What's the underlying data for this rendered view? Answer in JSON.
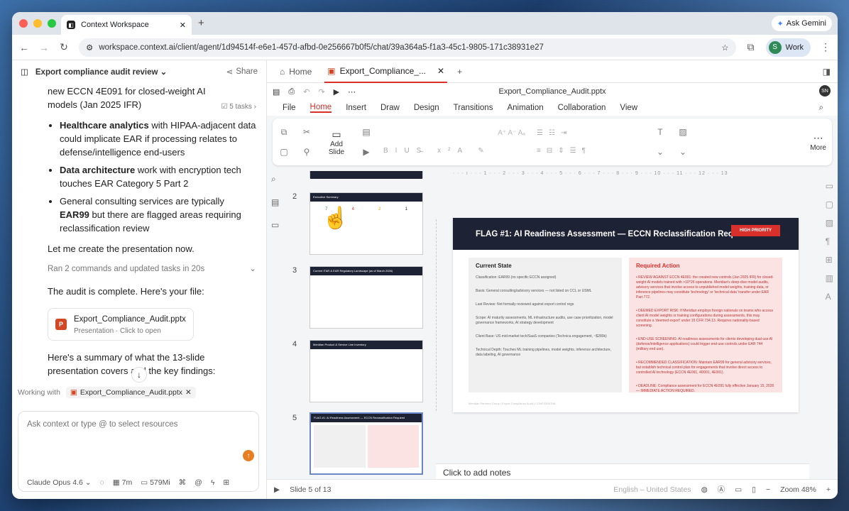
{
  "browser": {
    "tab_title": "Context Workspace",
    "gemini_label": "Ask Gemini",
    "url": "workspace.context.ai/client/agent/1d94514f-e6e1-457d-afbd-0e256667b0f5/chat/39a364a5-f1a3-45c1-9805-171c38931e27",
    "profile_initial": "S",
    "profile_label": "Work"
  },
  "left": {
    "title": "Export compliance audit review",
    "share_label": "Share",
    "intro_text": "new ECCN 4E091 for closed-weight AI models (Jan 2025 IFR)",
    "tasks_label": "5 tasks",
    "bullets": [
      {
        "bold": "Healthcare analytics",
        "text": " with HIPAA-adjacent data could implicate EAR if processing relates to defense/intelligence end-users"
      },
      {
        "bold": "Data architecture",
        "text": " work with encryption tech touches EAR Category 5 Part 2"
      },
      {
        "pre": "General consulting services are typically ",
        "bold": "EAR99",
        "text": " but there are flagged areas requiring reclassification review"
      }
    ],
    "create_text": "Let me create the presentation now.",
    "ran_text": "Ran 2 commands and updated tasks in 20s",
    "complete_text": "The audit is complete. Here's your file:",
    "file_name": "Export_Compliance_Audit.pptx",
    "file_sub": "Presentation · Click to open",
    "summary_text": "Here's a summary of what the 13-slide presentation covers and the key findings:",
    "working_with": "Working with",
    "working_file": "Export_Compliance_Audit.pptx",
    "input_placeholder": "Ask context or type @ to select resources",
    "model": "Claude Opus 4.6",
    "time": "7m",
    "memory": "579Mi"
  },
  "right": {
    "home_tab": "Home",
    "file_tab": "Export_Compliance_...",
    "file_title": "Export_Compliance_Audit.pptx",
    "user_initials": "SN",
    "menus": [
      "File",
      "Home",
      "Insert",
      "Draw",
      "Design",
      "Transitions",
      "Animation",
      "Collaboration",
      "View"
    ],
    "add_slide": "Add Slide",
    "more_label": "More",
    "thumbnails": [
      {
        "num": "2",
        "title": "Executive Summary",
        "stats": [
          "7",
          "4",
          "2",
          "1"
        ]
      },
      {
        "num": "3",
        "title": "Current ITAR & EAR Regulatory Landscape (as of March 2026)"
      },
      {
        "num": "4",
        "title": "Meridian Product & Service Line Inventory"
      },
      {
        "num": "5",
        "title": "FLAG #1: AI Readiness Assessment — ECCN Reclassification Required"
      }
    ],
    "slide_title": "FLAG #1: AI Readiness Assessment — ECCN Reclassification Requir",
    "badge": "HIGH PRIORITY",
    "current_state_heading": "Current State",
    "current_state_lines": [
      "Classification: EAR99 (no specific ECCN assigned)",
      "Basis: General consulting/advisory services — not listed on CCL or USML",
      "Last Review: Not formally reviewed against export control regs",
      "Scope: AI maturity assessments, ML infrastructure audits, use case prioritization, model governance frameworks, AI strategy development",
      "Client Base: US mid-market tech/SaaS companies (Technica engagement, ~$280k)",
      "Technical Depth: Touches ML training pipelines, model weights, inference architecture, data labeling, AI governance"
    ],
    "required_action_heading": "Required Action",
    "required_action_lines": [
      "• REVIEW AGAINST ECCN 4E091: the created new controls (Jan 2025 IFR) for closed-weight AI models trained with >10^26 operations. Meridian's deep-dive model audits, advisory services that involve access to unpublished model weights, training data, or inference pipelines may constitute 'technology' or 'technical data' transfer under EAR Part 772.",
      "• DEEMED EXPORT RISK: If Meridian employs foreign nationals on teams who access client AI model weights or training configurations during assessments, this may constitute a 'deemed export' under 15 CFR 734.13. Requires nationality-based screening.",
      "• END-USE SCREENING: AI readiness assessments for clients developing dual-use AI (defense/intelligence applications) could trigger end-use controls under EAR 744 (military end use).",
      "• RECOMMENDED CLASSIFICATION: Maintain EAR99 for general advisory services, but establish technical control plan for engagements that involve direct access to controlled AI technology (ECCN 4E091, 4D001, 4E001).",
      "• DEADLINE: Compliance assessment for ECCN 4E091 fully effective January 15, 2026 — IMMEDIATE ACTION REQUIRED."
    ],
    "slide_footer": "Meridian Partners Group | Export Compliance Audit | CONFIDENTIAL",
    "notes_placeholder": "Click to add notes",
    "slide_counter": "Slide 5 of 13",
    "language": "English – United States",
    "zoom": "Zoom 48%"
  },
  "colors": {
    "accent": "#d9302c",
    "slide_header": "#1e2235",
    "send": "#e67e22"
  }
}
